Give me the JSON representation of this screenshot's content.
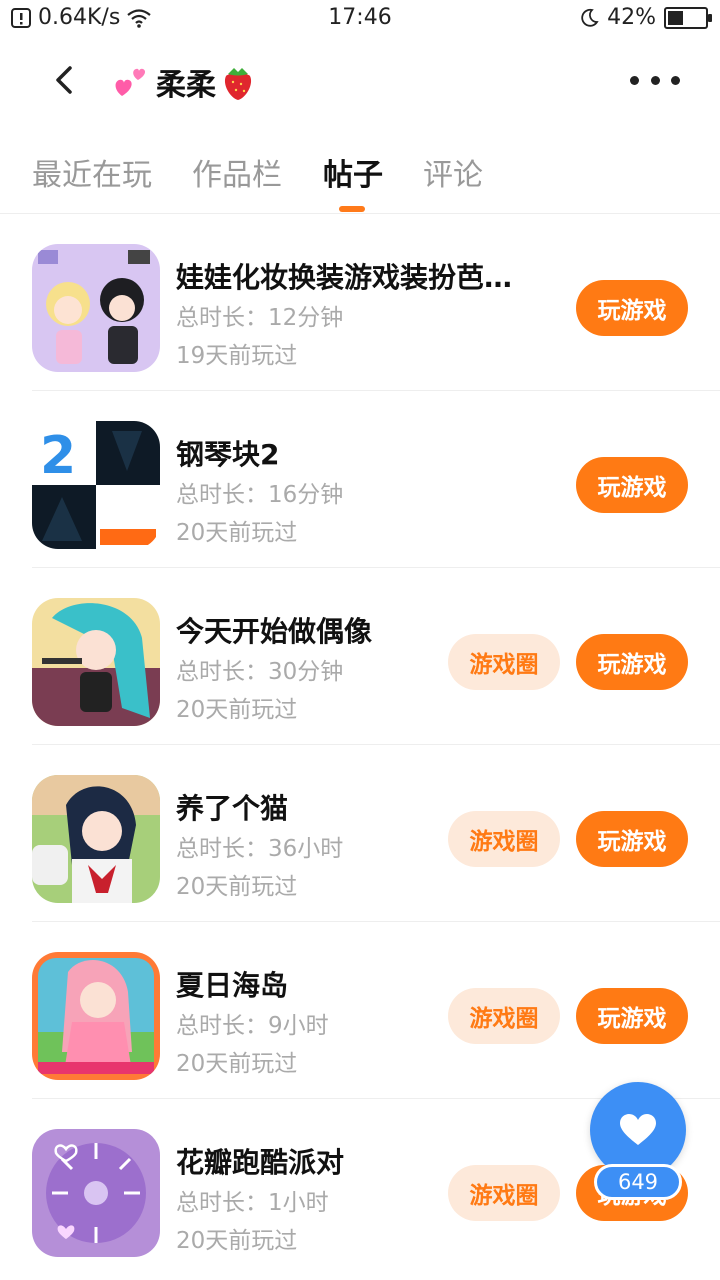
{
  "status_bar": {
    "speed": "0.64K/s",
    "time": "17:46",
    "battery": "42%",
    "battery_level": 0.42
  },
  "header": {
    "title": "柔柔",
    "back_icon": "back-arrow-icon",
    "more_icon": "more-icon"
  },
  "tabs": [
    {
      "label": "最近在玩",
      "active": false
    },
    {
      "label": "作品栏",
      "active": false
    },
    {
      "label": "帖子",
      "active": true
    },
    {
      "label": "评论",
      "active": false
    }
  ],
  "games": [
    {
      "name": "娃娃化妆换装游戏装扮芭比...",
      "duration": "总时长：12分钟",
      "last_played": "19天前玩过",
      "has_circle": false,
      "play_label": "玩游戏"
    },
    {
      "name": "钢琴块2",
      "duration": "总时长：16分钟",
      "last_played": "20天前玩过",
      "has_circle": false,
      "play_label": "玩游戏"
    },
    {
      "name": "今天开始做偶像",
      "duration": "总时长：30分钟",
      "last_played": "20天前玩过",
      "has_circle": true,
      "circle_label": "游戏圈",
      "play_label": "玩游戏"
    },
    {
      "name": "养了个猫",
      "duration": "总时长：36小时",
      "last_played": "20天前玩过",
      "has_circle": true,
      "circle_label": "游戏圈",
      "play_label": "玩游戏"
    },
    {
      "name": "夏日海岛",
      "duration": "总时长：9小时",
      "last_played": "20天前玩过",
      "has_circle": true,
      "circle_label": "游戏圈",
      "play_label": "玩游戏"
    },
    {
      "name": "花瓣跑酷派对",
      "duration": "总时长：1小时",
      "last_played": "20天前玩过",
      "has_circle": true,
      "circle_label": "游戏圈",
      "play_label": "玩游戏"
    }
  ],
  "like": {
    "count": "649",
    "icon": "heart-icon"
  },
  "colors": {
    "accent": "#ff7a14",
    "accent_light": "#fde9da",
    "like_blue": "#3d8ff5"
  }
}
